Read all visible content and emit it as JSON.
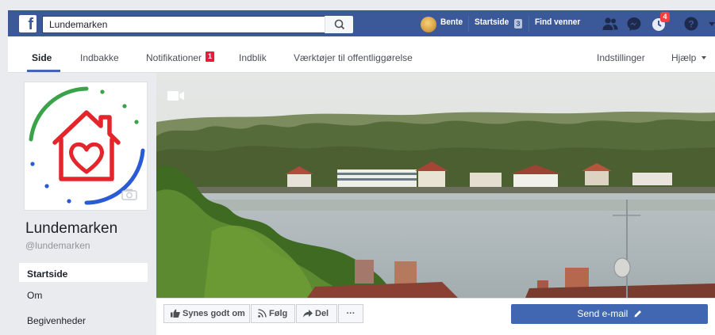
{
  "topbar": {
    "search_value": "Lundemarken",
    "user_name": "Bente",
    "home_label": "Startside",
    "home_count": "3",
    "find_friends": "Find venner",
    "notif_count": "4"
  },
  "subnav": {
    "tabs": [
      {
        "label": "Side"
      },
      {
        "label": "Indbakke"
      },
      {
        "label": "Notifikationer"
      },
      {
        "label": "Indblik"
      },
      {
        "label": "Værktøjer til offentliggørelse"
      }
    ],
    "notif_badge": "1",
    "settings": "Indstillinger",
    "help": "Hjælp"
  },
  "page": {
    "name": "Lundemarken",
    "handle": "@lundemarken"
  },
  "sidebar": {
    "items": [
      {
        "label": "Startside"
      },
      {
        "label": "Om"
      },
      {
        "label": "Begivenheder"
      }
    ]
  },
  "actions": {
    "like": "Synes godt om",
    "follow": "Følg",
    "share": "Del",
    "more": "···",
    "send_email": "Send e-mail"
  },
  "colors": {
    "brand_blue": "#3b5998",
    "button_blue": "#4267b2",
    "alert_red": "#e41e3f",
    "logo_green": "#3aa34a",
    "logo_red": "#e3262b",
    "logo_blue": "#2a5bd7"
  },
  "icons": [
    "facebook-logo-icon",
    "search-icon",
    "friend-requests-icon",
    "messenger-icon",
    "notifications-icon",
    "help-icon",
    "video-icon",
    "camera-icon",
    "like-icon",
    "rss-icon",
    "share-icon",
    "pencil-icon",
    "caret-down-icon"
  ]
}
